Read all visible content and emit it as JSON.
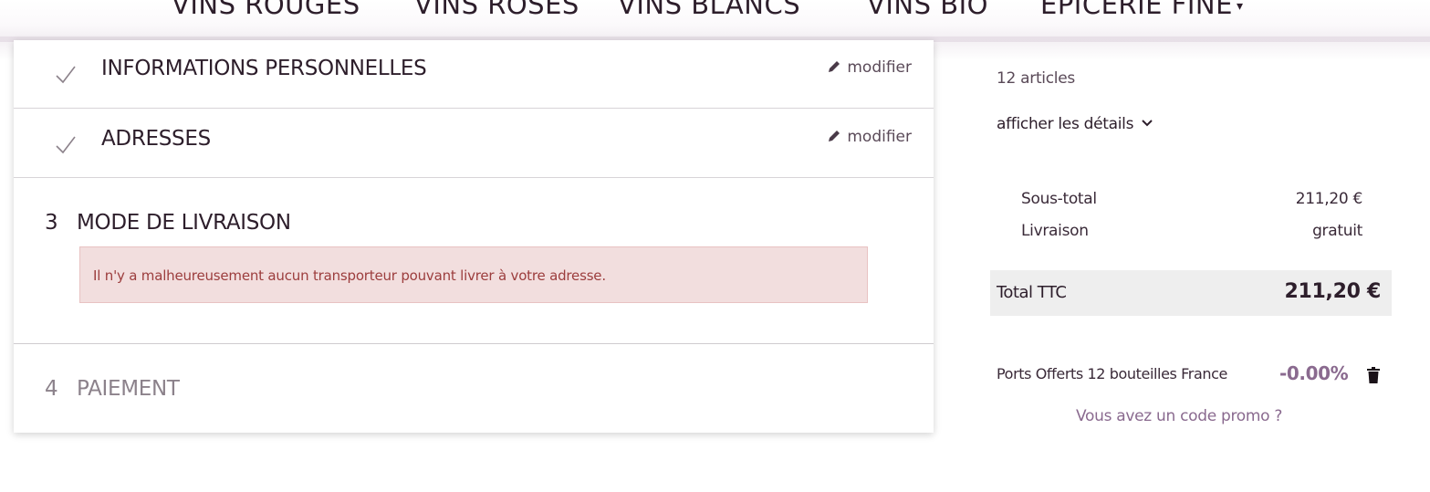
{
  "nav": {
    "items": [
      {
        "label": "VINS ROUGES"
      },
      {
        "label": "VINS ROSÉS"
      },
      {
        "label": "VINS BLANCS"
      },
      {
        "label": "VINS BIO"
      },
      {
        "label": "ÉPICERIE FINE"
      }
    ],
    "caret": "▾"
  },
  "checkout": {
    "steps": [
      {
        "title": "INFORMATIONS PERSONNELLES",
        "modify_label": "modifier",
        "status": "done"
      },
      {
        "title": "ADRESSES",
        "modify_label": "modifier",
        "status": "done"
      },
      {
        "number": "3",
        "title": "MODE DE LIVRAISON",
        "status": "current",
        "alert": "Il n'y a malheureusement aucun transporteur pouvant livrer à votre adresse."
      },
      {
        "number": "4",
        "title": "PAIEMENT",
        "status": "pending"
      }
    ]
  },
  "summary": {
    "articles": "12 articles",
    "show_details": "afficher les détails",
    "subtotal_label": "Sous-total",
    "subtotal_value": "211,20 €",
    "shipping_label": "Livraison",
    "shipping_value": "gratuit",
    "total_label": "Total TTC",
    "total_value": "211,20 €",
    "promo_name": "Ports Offerts 12 bouteilles France",
    "promo_value": "-0.00%",
    "promo_link": "Vous avez un code promo ?"
  },
  "colors": {
    "accent": "#8a6a8f",
    "alert_bg": "#f2dede",
    "alert_text": "#9c3d3d",
    "total_bg": "#eeeeee"
  },
  "icons": {
    "check": "check-icon",
    "pencil": "pencil-icon",
    "chevron": "chevron-down-icon",
    "trash": "trash-icon"
  }
}
